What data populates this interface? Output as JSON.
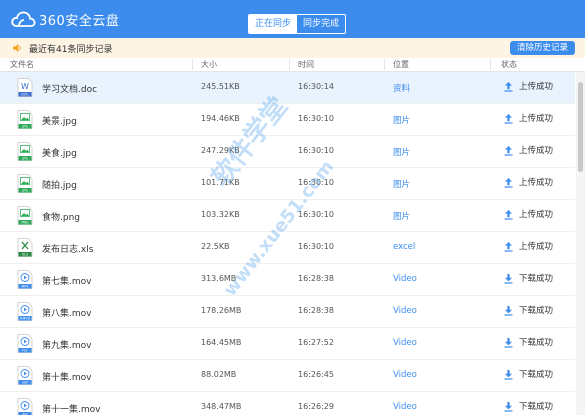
{
  "app": {
    "name": "360安全云盘"
  },
  "tabs": [
    {
      "label": "正在同步",
      "active": true
    },
    {
      "label": "同步完成",
      "active": false
    }
  ],
  "notice": {
    "text": "最近有41条同步记录",
    "clear_label": "清除历史记录"
  },
  "columns": {
    "name": "文件名",
    "size": "大小",
    "time": "时间",
    "location": "位置",
    "status": "状态"
  },
  "files": [
    {
      "name": "学习文档.doc",
      "type": "doc",
      "badge": "DOC",
      "size": "245.51KB",
      "time": "16:30:14",
      "location": "资料",
      "status": "上传成功",
      "direction": "up"
    },
    {
      "name": "美景.jpg",
      "type": "img",
      "badge": "JPG",
      "size": "194.46KB",
      "time": "16:30:10",
      "location": "图片",
      "status": "上传成功",
      "direction": "up"
    },
    {
      "name": "美食.jpg",
      "type": "img",
      "badge": "JPG",
      "size": "247.29KB",
      "time": "16:30:10",
      "location": "图片",
      "status": "上传成功",
      "direction": "up"
    },
    {
      "name": "随拍.jpg",
      "type": "img",
      "badge": "JPG",
      "size": "101.71KB",
      "time": "16:30:10",
      "location": "图片",
      "status": "上传成功",
      "direction": "up"
    },
    {
      "name": "食物.png",
      "type": "img",
      "badge": "PNG",
      "size": "103.32KB",
      "time": "16:30:10",
      "location": "图片",
      "status": "上传成功",
      "direction": "up"
    },
    {
      "name": "发布日志.xls",
      "type": "xls",
      "badge": "XLS",
      "size": "22.5KB",
      "time": "16:30:10",
      "location": "excel",
      "status": "上传成功",
      "direction": "up"
    },
    {
      "name": "第七集.mov",
      "type": "video",
      "badge": "MP4",
      "size": "313.6MB",
      "time": "16:28:38",
      "location": "Video",
      "status": "下载成功",
      "direction": "down"
    },
    {
      "name": "第八集.mov",
      "type": "video",
      "badge": "RMVB",
      "size": "178.26MB",
      "time": "16:28:38",
      "location": "Video",
      "status": "下载成功",
      "direction": "down"
    },
    {
      "name": "第九集.mov",
      "type": "video",
      "badge": "FLV",
      "size": "164.45MB",
      "time": "16:27:52",
      "location": "Video",
      "status": "下载成功",
      "direction": "down"
    },
    {
      "name": "第十集.mov",
      "type": "video",
      "badge": "3GP",
      "size": "88.02MB",
      "time": "16:26:45",
      "location": "Video",
      "status": "下载成功",
      "direction": "down"
    },
    {
      "name": "第十一集.mov",
      "type": "video",
      "badge": "AVI",
      "size": "348.47MB",
      "time": "16:26:29",
      "location": "Video",
      "status": "下载成功",
      "direction": "down"
    }
  ],
  "watermark": {
    "line1": "软件学堂",
    "line2": "www.xue51.com"
  },
  "colors": {
    "accent": "#3c8cee",
    "notice_bg": "#fdf4e4",
    "notice_icon": "#f5a623"
  }
}
